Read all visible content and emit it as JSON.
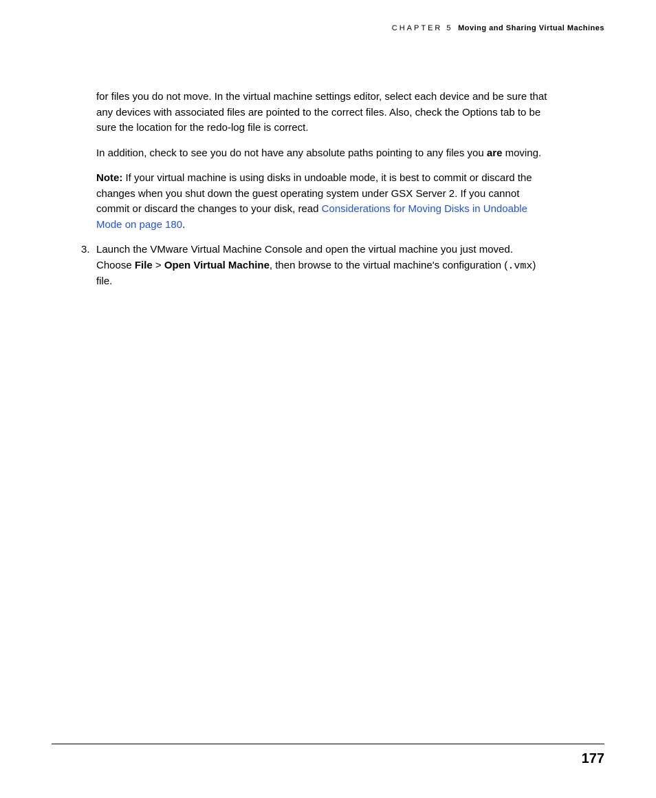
{
  "header": {
    "chapter": "CHAPTER 5",
    "title": "Moving and Sharing Virtual Machines"
  },
  "paragraphs": {
    "p1": "for files you do not move. In the virtual machine settings editor, select each device and be sure that any devices with associated files are pointed to the correct files. Also, check the Options tab to be sure the location for the redo-log file is correct.",
    "p2_a": "In addition, check to see you do not have any absolute paths pointing to any files you ",
    "p2_b": "are",
    "p2_c": " moving.",
    "p3_note": "Note:",
    "p3_a": "  If your virtual machine is using disks in undoable mode, it is best to commit or discard the changes when you shut down the guest operating system under GSX Server 2. If you cannot commit or discard the changes to your disk, read ",
    "p3_link": "Considerations for Moving Disks in Undoable Mode on page 180",
    "p3_b": ".",
    "list_num": "3.",
    "p4_a": "Launch the VMware Virtual Machine Console and open the virtual machine you just moved. Choose ",
    "p4_b": "File",
    "p4_c": " > ",
    "p4_d": "Open Virtual Machine",
    "p4_e": ", then browse to the virtual machine's configuration (",
    "p4_mono": ".vmx",
    "p4_f": ") file."
  },
  "page_number": "177"
}
